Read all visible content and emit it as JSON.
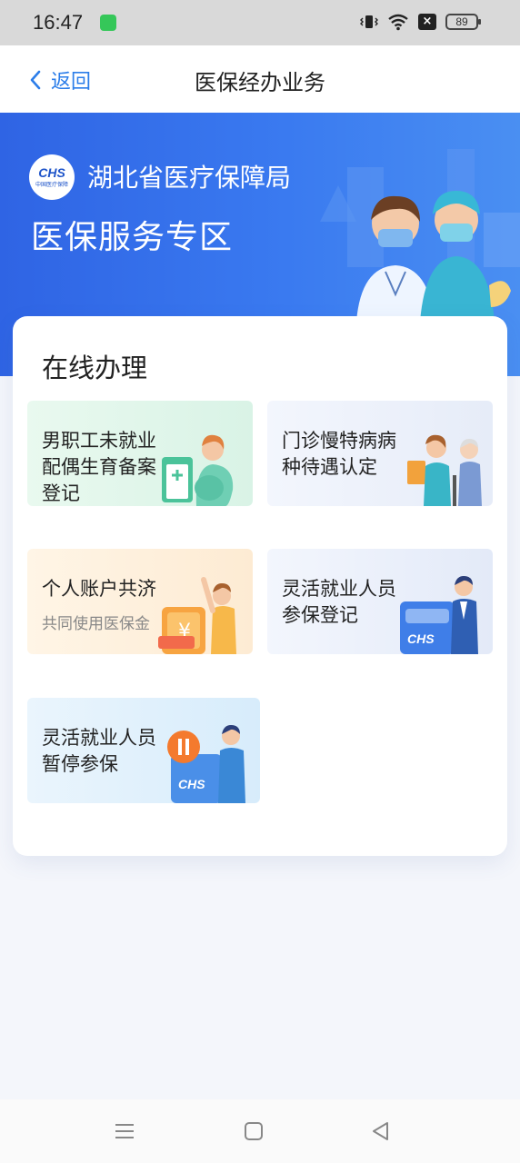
{
  "status_bar": {
    "time": "16:47",
    "battery": "89",
    "icons": [
      "app-notification-icon",
      "vibrate-icon",
      "wifi-icon",
      "no-sim-icon",
      "battery-icon"
    ]
  },
  "nav": {
    "back_label": "返回",
    "title": "医保经办业务"
  },
  "banner": {
    "logo_text": "CHS",
    "logo_sub": "中国医疗保障",
    "org_name": "湖北省医疗保障局",
    "zone_title": "医保服务专区"
  },
  "online": {
    "title": "在线办理",
    "tiles": [
      {
        "lines": [
          "男职工未就业",
          "配偶生育备案",
          "登记"
        ],
        "subtitle": "",
        "icon": "pregnant-woman-clipboard-icon"
      },
      {
        "lines": [
          "门诊慢特病病",
          "种待遇认定"
        ],
        "subtitle": "",
        "icon": "nurse-elderly-icon"
      },
      {
        "lines": [
          "个人账户共济"
        ],
        "subtitle": "共同使用医保金",
        "icon": "yuan-wallet-icon"
      },
      {
        "lines": [
          "灵活就业人员",
          "参保登记"
        ],
        "subtitle": "",
        "icon": "worker-card-icon"
      },
      {
        "lines": [
          "灵活就业人员",
          "暂停参保"
        ],
        "subtitle": "",
        "icon": "pause-card-icon"
      }
    ]
  },
  "system_nav": {
    "icons": [
      "menu-icon",
      "home-icon",
      "back-triangle-icon"
    ]
  },
  "colors": {
    "accent": "#2b7de9",
    "banner": "#3a7af0"
  }
}
